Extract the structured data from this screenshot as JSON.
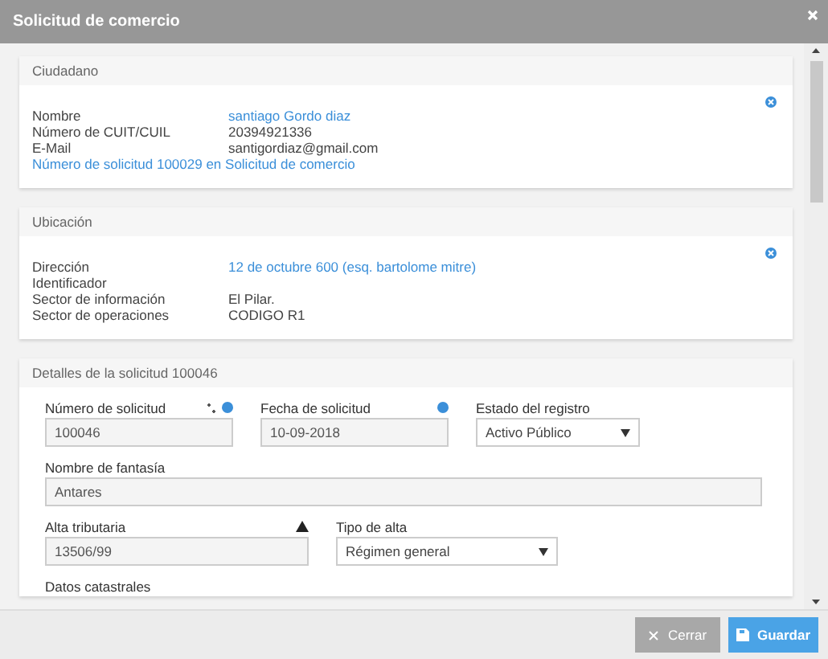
{
  "window": {
    "title": "Solicitud de comercio"
  },
  "ciudadano": {
    "title": "Ciudadano",
    "rows": [
      {
        "label": "Nombre",
        "value": "santiago Gordo diaz",
        "kind": "link"
      },
      {
        "label": "Número de CUIT/CUIL",
        "value": "20394921336",
        "kind": "text"
      },
      {
        "label": "E-Mail",
        "value": "santigordiaz@gmail.com",
        "kind": "text"
      }
    ],
    "link": "Número de solicitud 100029 en Solicitud de comercio"
  },
  "ubicacion": {
    "title": "Ubicación",
    "rows": [
      {
        "label": "Dirección",
        "value": "12 de octubre 600 (esq. bartolome mitre)",
        "kind": "link"
      },
      {
        "label": "Identificador",
        "value": "",
        "kind": "text"
      },
      {
        "label": "Sector de información",
        "value": "El Pilar.",
        "kind": "text"
      },
      {
        "label": "Sector de operaciones",
        "value": "CODIGO R1",
        "kind": "text"
      }
    ]
  },
  "detalles": {
    "title": "Detalles de la solicitud 100046",
    "numero": {
      "label": "Número de solicitud",
      "value": "100046"
    },
    "fecha": {
      "label": "Fecha de solicitud",
      "value": "10-09-2018"
    },
    "estado": {
      "label": "Estado del registro",
      "value": "Activo Público"
    },
    "fantasia": {
      "label": "Nombre de fantasía",
      "value": "Antares"
    },
    "alta": {
      "label": "Alta tributaria",
      "value": "13506/99"
    },
    "tipo": {
      "label": "Tipo de alta",
      "value": "Régimen general"
    },
    "next_label": "Datos catastrales"
  },
  "buttons": [
    {
      "label": "Cerrar",
      "kind": "close"
    },
    {
      "label": "Guardar",
      "kind": "save"
    }
  ]
}
